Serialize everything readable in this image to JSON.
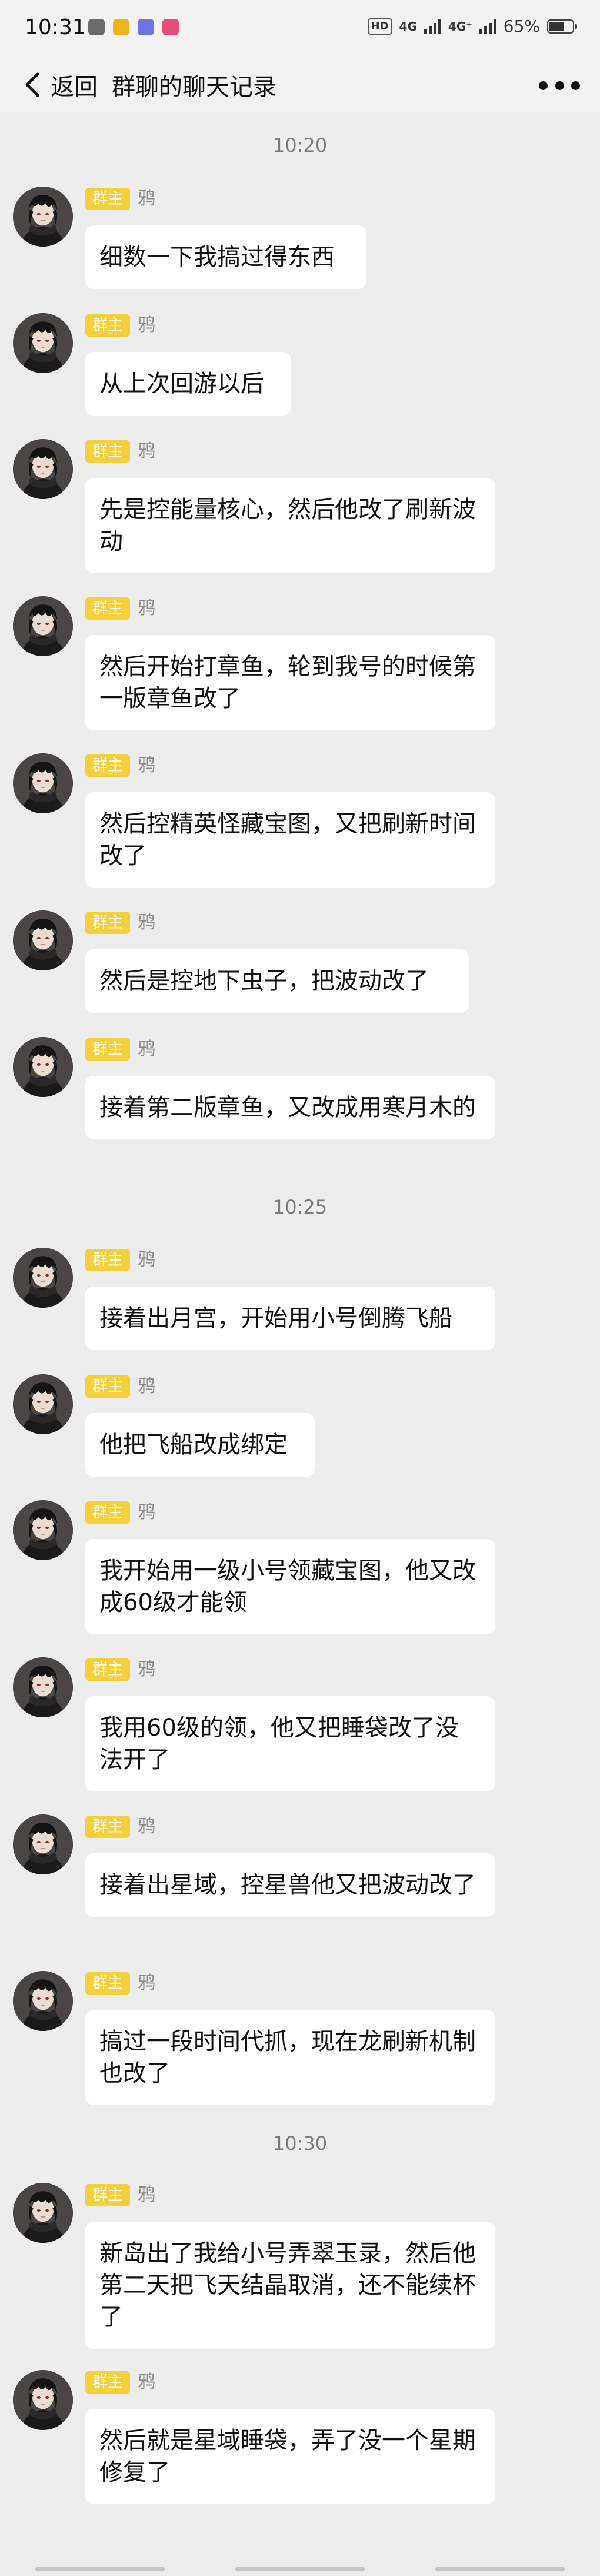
{
  "status_bar": {
    "time": "10:31",
    "net_1": "4G",
    "net_2": "4G⁺",
    "hd": "HD",
    "battery_text": "65%",
    "battery_level": 0.65
  },
  "nav": {
    "back_label": "返回",
    "title": "群聊的聊天记录"
  },
  "timestamps": [
    "10:20",
    "10:25",
    "10:30"
  ],
  "messages": [
    {
      "role": "群主",
      "nick": "鸦",
      "text": "细数一下我搞过得东西"
    },
    {
      "role": "群主",
      "nick": "鸦",
      "text": "从上次回游以后"
    },
    {
      "role": "群主",
      "nick": "鸦",
      "text": "先是控能量核心，然后他改了刷新波动"
    },
    {
      "role": "群主",
      "nick": "鸦",
      "text": "然后开始打章鱼，轮到我号的时候第一版章鱼改了"
    },
    {
      "role": "群主",
      "nick": "鸦",
      "text": "然后控精英怪藏宝图，又把刷新时间改了"
    },
    {
      "role": "群主",
      "nick": "鸦",
      "text": "然后是控地下虫子，把波动改了"
    },
    {
      "role": "群主",
      "nick": "鸦",
      "text": "接着第二版章鱼，又改成用寒月木的"
    },
    {
      "role": "群主",
      "nick": "鸦",
      "text": "接着出月宫，开始用小号倒腾飞船"
    },
    {
      "role": "群主",
      "nick": "鸦",
      "text": "他把飞船改成绑定"
    },
    {
      "role": "群主",
      "nick": "鸦",
      "text": "我开始用一级小号领藏宝图，他又改成60级才能领"
    },
    {
      "role": "群主",
      "nick": "鸦",
      "text": "我用60级的领，他又把睡袋改了没法开了"
    },
    {
      "role": "群主",
      "nick": "鸦",
      "text": "接着出星域，控星兽他又把波动改了"
    },
    {
      "role": "群主",
      "nick": "鸦",
      "text": "搞过一段时间代抓，现在龙刷新机制也改了"
    },
    {
      "role": "群主",
      "nick": "鸦",
      "text": "新岛出了我给小号弄翠玉录，然后他第二天把飞天结晶取消，还不能续杯了"
    },
    {
      "role": "群主",
      "nick": "鸦",
      "text": "然后就是星域睡袋，弄了没一个星期修复了"
    }
  ]
}
